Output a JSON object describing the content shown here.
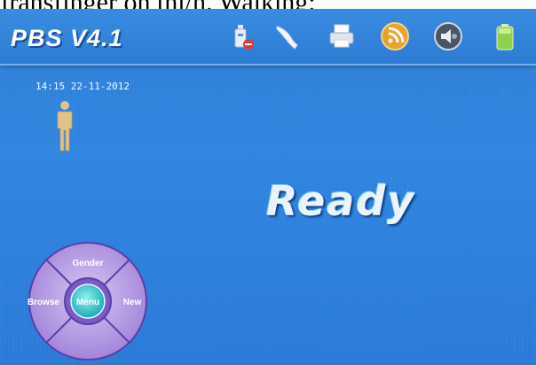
{
  "caption": {
    "text": "transfinger on thi/h. Walking:"
  },
  "header": {
    "title": "PBS V4.1",
    "icons": [
      "usb-disconnected-icon",
      "probe-icon",
      "printer-icon",
      "rss-icon",
      "speaker-icon",
      "battery-icon"
    ]
  },
  "main": {
    "datetime": "14:15 22-11-2012",
    "status": "Ready",
    "person_icon": "person-icon"
  },
  "nav_wheel": {
    "top_label": "Gender",
    "left_label": "Browse",
    "right_label": "New",
    "center_label": "Menu",
    "colors": {
      "ring": "#b79be4",
      "center": "#3fd0d0"
    }
  }
}
